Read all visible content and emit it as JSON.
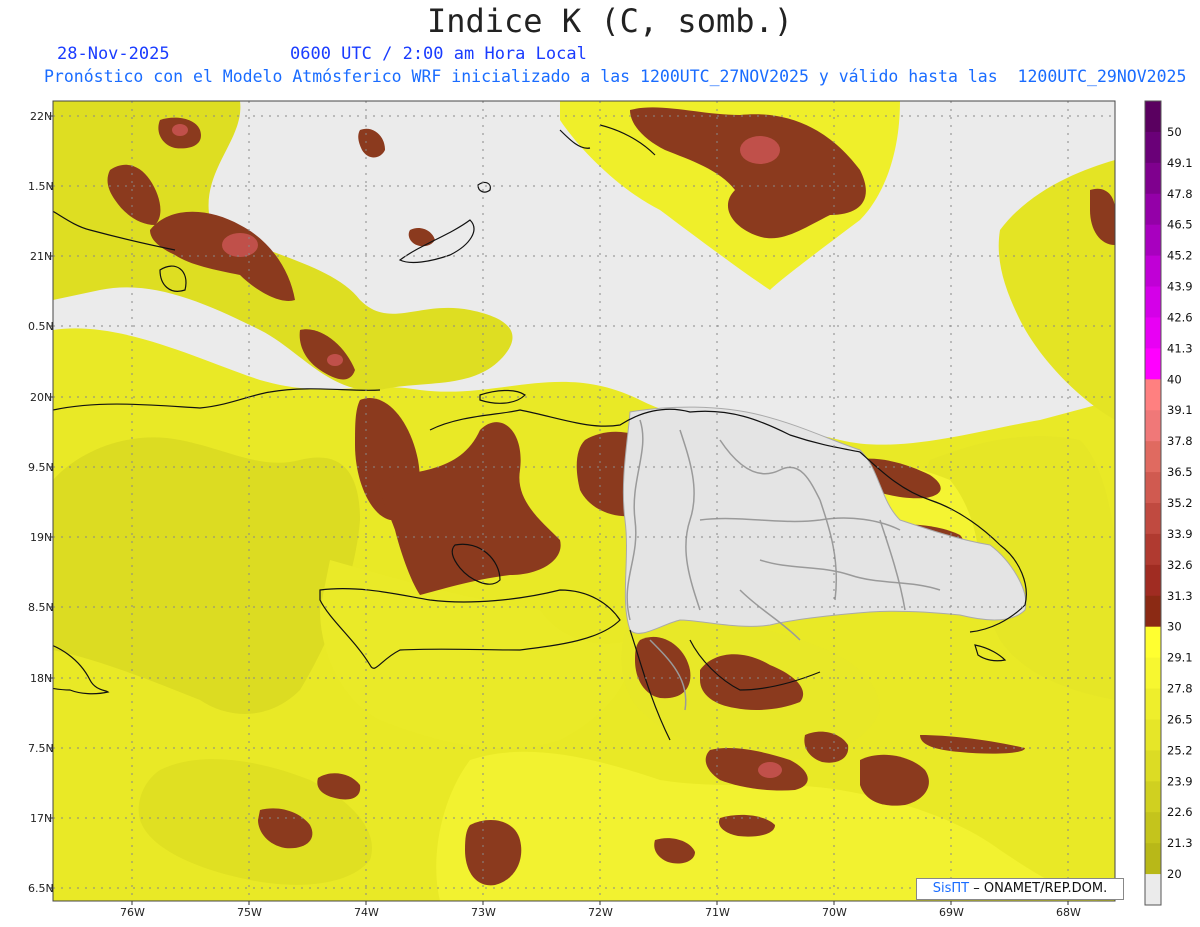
{
  "header": {
    "title": "Indice K (C, somb.)",
    "date": "28-Nov-2025",
    "valid_time": "0600 UTC / 2:00 am Hora Local",
    "description": "Pronóstico con el Modelo Atmósferico WRF inicializado a las 1200UTC_27NOV2025 y válido hasta las  1200UTC_29NOV2025"
  },
  "axes": {
    "lat_labels": [
      "22N",
      "1.5N",
      "21N",
      "0.5N",
      "20N",
      "9.5N",
      "19N",
      "8.5N",
      "18N",
      "7.5N",
      "17N",
      "6.5N"
    ],
    "lon_labels": [
      "76W",
      "75W",
      "74W",
      "73W",
      "72W",
      "71W",
      "70W",
      "69W",
      "68W"
    ]
  },
  "colorbar": {
    "labels": [
      "50",
      "49.1",
      "47.8",
      "46.5",
      "45.2",
      "43.9",
      "42.6",
      "41.3",
      "40",
      "39.1",
      "37.8",
      "36.5",
      "35.2",
      "33.9",
      "32.6",
      "31.3",
      "30",
      "29.1",
      "27.8",
      "26.5",
      "25.2",
      "23.9",
      "22.6",
      "21.3",
      "20"
    ],
    "colors": [
      "#5a0060",
      "#6a0078",
      "#7f008e",
      "#9400a8",
      "#a800bf",
      "#c000d6",
      "#d400e8",
      "#e800f4",
      "#ff00ff",
      "#ff8080",
      "#f07878",
      "#e06a60",
      "#d05a50",
      "#c04a40",
      "#b03a30",
      "#a02c22",
      "#8b2a14",
      "#ffff30",
      "#f7f730",
      "#eeee2c",
      "#e6e628",
      "#dcdc24",
      "#d0d020",
      "#c4c41c",
      "#b8b818",
      "#ebebeb"
    ]
  },
  "credit": {
    "brand": "SisПT",
    "text": "– ONAMET/REP.DOM."
  }
}
